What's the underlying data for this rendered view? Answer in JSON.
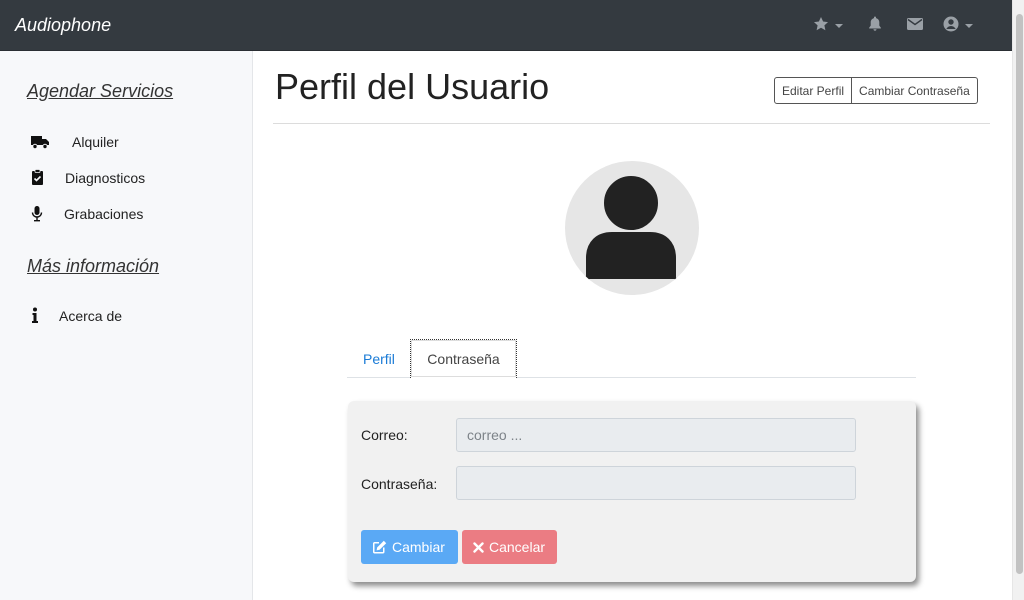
{
  "navbar": {
    "brand": "Audiophone",
    "icons": [
      "star-icon",
      "bell-icon",
      "envelope-icon",
      "user-circle-icon"
    ]
  },
  "sidebar": {
    "section1": "Agendar Servicios",
    "items": [
      {
        "label": "Alquiler",
        "icon": "truck-icon"
      },
      {
        "label": "Diagnosticos",
        "icon": "clipboard-check-icon"
      },
      {
        "label": "Grabaciones",
        "icon": "microphone-icon"
      }
    ],
    "section2": "Más información",
    "items2": [
      {
        "label": "Acerca de",
        "icon": "info-icon"
      }
    ]
  },
  "main": {
    "title": "Perfil del Usuario",
    "buttons": {
      "edit": "Editar Perfil",
      "change_password": "Cambiar Contraseña"
    },
    "tabs": [
      {
        "label": "Perfil"
      },
      {
        "label": "Contraseña",
        "active": true
      }
    ],
    "form": {
      "email_label": "Correo:",
      "email_placeholder": "correo ...",
      "email_value": "",
      "password_label": "Contraseña:",
      "password_value": "",
      "submit_label": "Cambiar",
      "cancel_label": "Cancelar"
    }
  },
  "colors": {
    "navbar": "#343a40",
    "primary": "#5aa9f5",
    "danger": "#eb7c83",
    "link": "#1a7bd6"
  }
}
